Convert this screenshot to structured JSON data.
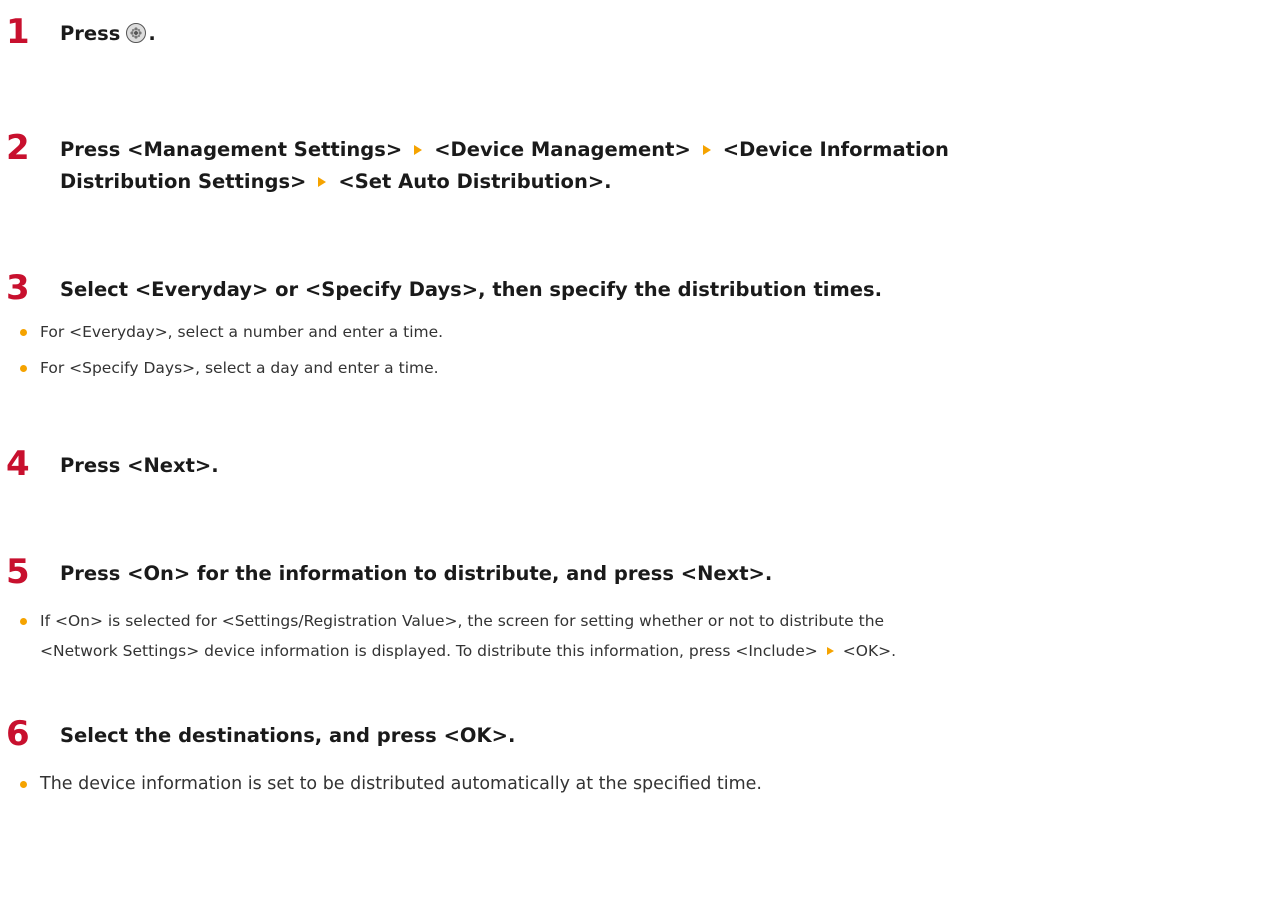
{
  "steps": [
    {
      "number": "1",
      "title_pre": "Press",
      "icon": "home-key-icon",
      "title_post": "."
    },
    {
      "number": "2",
      "title_line1": [
        "Press <Management Settings>",
        "<Device Management>",
        "<Device Information"
      ],
      "title_line2": [
        "Distribution Settings>",
        "<Set Auto Distribution>."
      ]
    },
    {
      "number": "3",
      "title": "Select <Everyday> or <Specify Days>, then specify the distribution times.",
      "bullets": [
        "For <Everyday>, select a number and enter a time.",
        "For <Specify Days>, select a day and enter a time."
      ]
    },
    {
      "number": "4",
      "title": "Press <Next>."
    },
    {
      "number": "5",
      "title": "Press <On> for the information to distribute, and press <Next>.",
      "bullet_line1": "If <On> is selected for <Settings/Registration Value>, the screen for setting whether or not to distribute the",
      "bullet_line2_pre": "<Network Settings> device information is displayed. To distribute this information, press <Include>",
      "bullet_line2_post": "<OK>."
    },
    {
      "number": "6",
      "title": "Select the destinations, and press <OK>.",
      "bullets": [
        "The device information is set to be distributed automatically at the specified time."
      ]
    }
  ],
  "colors": {
    "step_number": "#c8102e",
    "arrow": "#f5a300",
    "bullet": "#f5a300"
  }
}
